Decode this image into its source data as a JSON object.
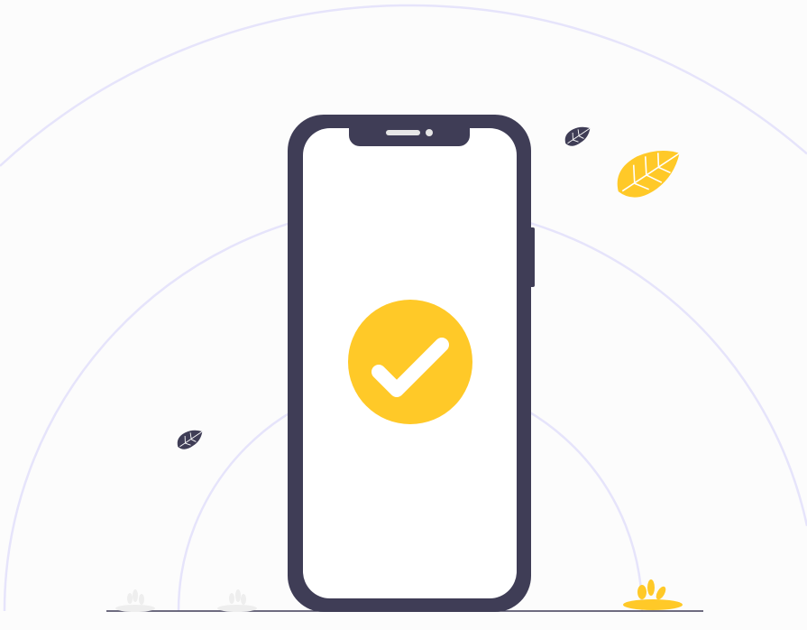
{
  "illustration": {
    "subject": "phone-verified",
    "colors": {
      "background": "#fcfcfc",
      "arc": "#e6e4fb",
      "phone": "#3f3d56",
      "screen": "#ffffff",
      "accent": "#ffc928",
      "plant_faded": "#eeeeee",
      "ground": "#3f3d56"
    }
  }
}
